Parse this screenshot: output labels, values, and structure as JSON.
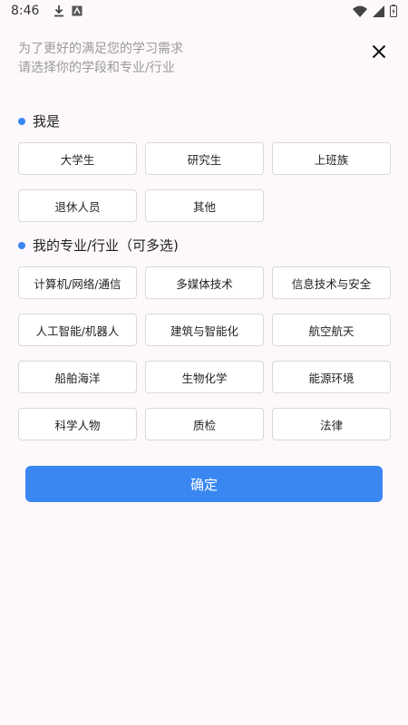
{
  "status_bar": {
    "time": "8:46",
    "icons": [
      "download-icon",
      "app-notification-icon",
      "wifi-icon",
      "signal-icon",
      "battery-icon"
    ]
  },
  "intro": {
    "line1": "为了更好的满足您的学习需求",
    "line2": "请选择你的学段和专业/行业"
  },
  "identity": {
    "title": "我是",
    "options": [
      "大学生",
      "研究生",
      "上班族",
      "退休人员",
      "其他"
    ]
  },
  "major": {
    "title": "我的专业/行业（可多选)",
    "options": [
      "计算机/网络/通信",
      "多媒体技术",
      "信息技术与安全",
      "人工智能/机器人",
      "建筑与智能化",
      "航空航天",
      "船舶海洋",
      "生物化学",
      "能源环境",
      "科学人物",
      "质检",
      "法律"
    ]
  },
  "confirm_label": "确定",
  "colors": {
    "accent": "#3a87f2",
    "background": "#fcf8fc",
    "border": "#d9d9d9",
    "hint_text": "#9a9a9a"
  }
}
